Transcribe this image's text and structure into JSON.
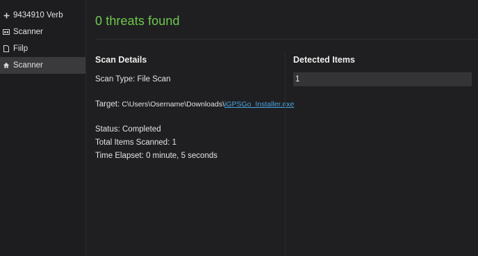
{
  "sidebar": {
    "items": [
      {
        "icon": "plus-icon",
        "label": "9434910 Verb",
        "active": false
      },
      {
        "icon": "scanner-icon",
        "label": "Scanner",
        "active": false
      },
      {
        "icon": "file-icon",
        "label": "Fiilp",
        "active": false
      },
      {
        "icon": "home-icon",
        "label": "Scanner",
        "active": true
      }
    ]
  },
  "header": {
    "title": "0 threats found"
  },
  "scan_details": {
    "title": "Scan Details",
    "scan_type": "Scan Type: File Scan",
    "target_label": "Target: ",
    "target_path": "C\\Users\\Osername\\Downloads\\",
    "target_file": "iGPSGo_Installer.exe",
    "status": "Status: Completed",
    "total_items": "Total Items Scanned: 1",
    "time_elapsed": "Time Elapset: 0 minute, 5 seconds"
  },
  "detected_items": {
    "title": "Detected Items",
    "rows": [
      "1"
    ]
  },
  "colors": {
    "success": "#6fc94e",
    "link": "#4aa3df",
    "background": "#1f1f21"
  }
}
